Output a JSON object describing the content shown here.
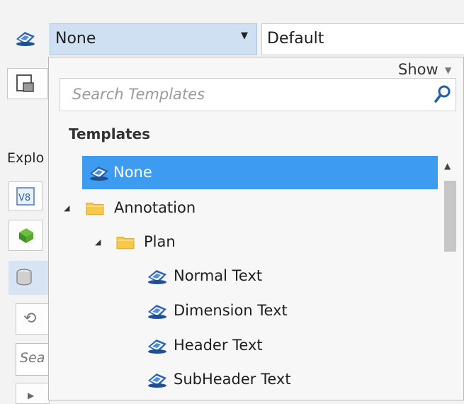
{
  "toolbar": {
    "template_selector": {
      "value": "None",
      "icon": "text-style-icon"
    },
    "style_selector": {
      "value": "Default"
    }
  },
  "left_panel": {
    "explorer_label": "Explo",
    "search_label": "Sea",
    "icons": [
      "element-selection-icon",
      "v8-file-icon",
      "model-icon",
      "database-icon",
      "refresh-icon"
    ]
  },
  "dropdown": {
    "show_label": "Show",
    "search_placeholder": "Search Templates",
    "section_heading": "Templates",
    "tree": {
      "none_item": "None",
      "annotation": "Annotation",
      "plan": "Plan",
      "items": [
        "Normal Text",
        "Dimension Text",
        "Header Text",
        "SubHeader Text"
      ]
    }
  },
  "colors": {
    "selection": "#3d9bf0",
    "combo_active": "#cfe0f3",
    "folder": "#f6c94a",
    "icon_blue": "#2c64b3"
  }
}
